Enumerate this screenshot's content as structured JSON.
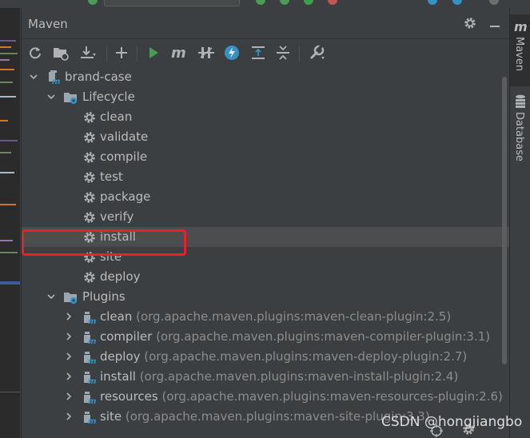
{
  "panel": {
    "title": "Maven",
    "header_icons": [
      "gear-icon",
      "minimize-icon"
    ]
  },
  "toolbar": {
    "buttons": [
      {
        "name": "reload-icon"
      },
      {
        "name": "add-sources-icon"
      },
      {
        "name": "download-icon"
      },
      {
        "name": "add-icon"
      },
      {
        "name": "run-icon"
      },
      {
        "name": "execute-goal-icon"
      },
      {
        "name": "skip-tests-icon"
      },
      {
        "name": "offline-icon"
      },
      {
        "name": "show-dependencies-icon"
      },
      {
        "name": "collapse-all-icon"
      },
      {
        "name": "settings-wrench-icon"
      }
    ]
  },
  "tree": {
    "project": {
      "label": "brand-case"
    },
    "lifecycle": {
      "label": "Lifecycle",
      "goals": [
        "clean",
        "validate",
        "compile",
        "test",
        "package",
        "verify",
        "install",
        "site",
        "deploy"
      ],
      "selected": "install"
    },
    "plugins": {
      "label": "Plugins",
      "items": [
        {
          "name": "clean",
          "detail": "(org.apache.maven.plugins:maven-clean-plugin:2.5)"
        },
        {
          "name": "compiler",
          "detail": "(org.apache.maven.plugins:maven-compiler-plugin:3.1)"
        },
        {
          "name": "deploy",
          "detail": "(org.apache.maven.plugins:maven-deploy-plugin:2.7)"
        },
        {
          "name": "install",
          "detail": "(org.apache.maven.plugins:maven-install-plugin:2.4)"
        },
        {
          "name": "resources",
          "detail": "(org.apache.maven.plugins:maven-resources-plugin:2.6)"
        },
        {
          "name": "site",
          "detail": "(org.apache.maven.plugins:maven-site-plugin:3.3)"
        }
      ]
    }
  },
  "right_tabs": [
    {
      "label": "Maven",
      "icon": "maven-m-icon"
    },
    {
      "label": "Database",
      "icon": "database-icon"
    }
  ],
  "watermark": "CSDN @hongjiangbo",
  "colors": {
    "background": "#3c3f41",
    "selection": "#4b4d4f",
    "text": "#bbbbbb",
    "muted_text": "#8c8c8c",
    "highlight_border": "#e8202a",
    "run_green": "#499c54",
    "offline_blue": "#3592c4"
  }
}
